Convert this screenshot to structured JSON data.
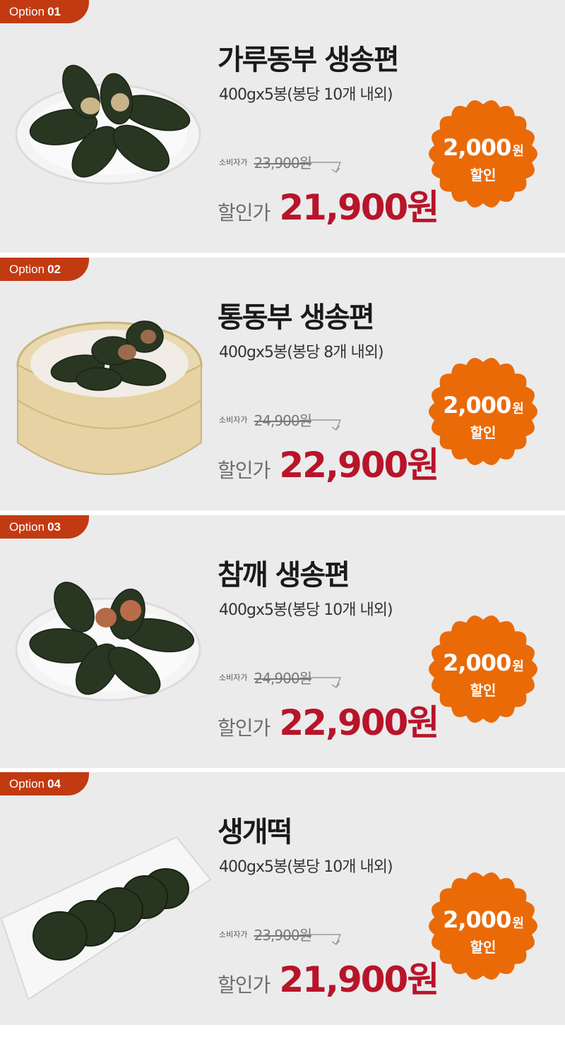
{
  "theme": {
    "page_background": "#ffffff",
    "card_background": "#ebebeb",
    "tab_color": "#c23a12",
    "badge_color": "#ea6a08",
    "sale_price_color": "#b8142a"
  },
  "options": [
    {
      "tab_label": "Option",
      "tab_number": "01",
      "name": "가루동부 생송편",
      "spec": "400gx5봉(봉당 10개 내외)",
      "consumer_label": "소비자가",
      "consumer_price": "23,900원",
      "sale_label": "할인가",
      "sale_price": "21,900원",
      "discount_amount": "2,000",
      "discount_unit": "원",
      "discount_label": "할인",
      "image_icon": "songpyeon-plate-image"
    },
    {
      "tab_label": "Option",
      "tab_number": "02",
      "name": "통동부 생송편",
      "spec": "400gx5봉(봉당 8개 내외)",
      "consumer_label": "소비자가",
      "consumer_price": "24,900원",
      "sale_label": "할인가",
      "sale_price": "22,900원",
      "discount_amount": "2,000",
      "discount_unit": "원",
      "discount_label": "할인",
      "image_icon": "songpyeon-steamer-image"
    },
    {
      "tab_label": "Option",
      "tab_number": "03",
      "name": "참깨 생송편",
      "spec": "400gx5봉(봉당 10개 내외)",
      "consumer_label": "소비자가",
      "consumer_price": "24,900원",
      "sale_label": "할인가",
      "sale_price": "22,900원",
      "discount_amount": "2,000",
      "discount_unit": "원",
      "discount_label": "할인",
      "image_icon": "sesame-songpyeon-plate-image"
    },
    {
      "tab_label": "Option",
      "tab_number": "04",
      "name": "생개떡",
      "spec": "400gx5봉(봉당 10개 내외)",
      "consumer_label": "소비자가",
      "consumer_price": "23,900원",
      "sale_label": "할인가",
      "sale_price": "21,900원",
      "discount_amount": "2,000",
      "discount_unit": "원",
      "discount_label": "할인",
      "image_icon": "gaetteok-tray-image"
    }
  ]
}
